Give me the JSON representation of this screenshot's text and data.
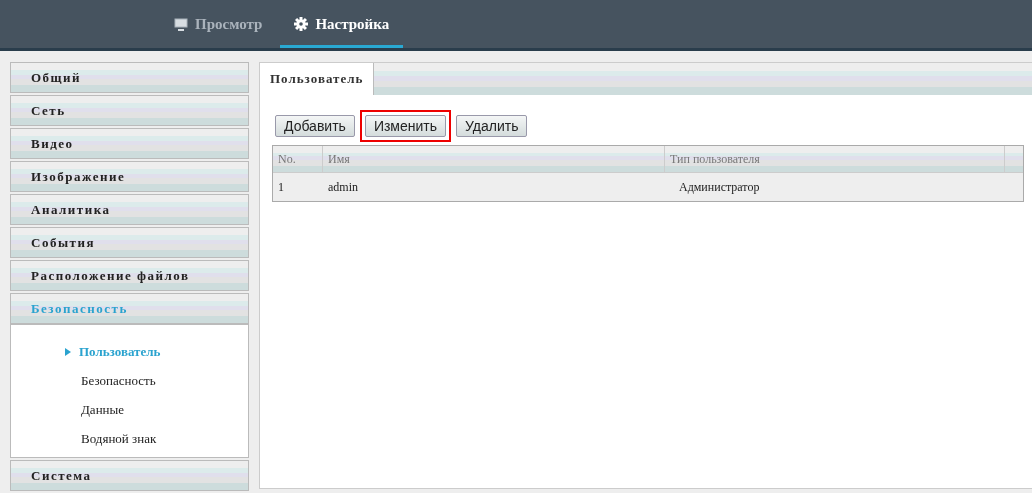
{
  "nav": [
    {
      "label": "Просмотр",
      "selected": false
    },
    {
      "label": "Настройка",
      "selected": true
    }
  ],
  "sidebar": {
    "items": [
      {
        "label": "Общий",
        "selected": false
      },
      {
        "label": "Сеть",
        "selected": false
      },
      {
        "label": "Видео",
        "selected": false
      },
      {
        "label": "Изображение",
        "selected": false
      },
      {
        "label": "Аналитика",
        "selected": false
      },
      {
        "label": "События",
        "selected": false
      },
      {
        "label": "Расположение файлов",
        "selected": false
      },
      {
        "label": "Безопасность",
        "selected": true,
        "expanded": true,
        "children": [
          {
            "label": "Пользователь",
            "selected": true
          },
          {
            "label": "Безопасность",
            "selected": false
          },
          {
            "label": "Данные",
            "selected": false
          },
          {
            "label": "Водяной знак",
            "selected": false
          }
        ]
      },
      {
        "label": "Система",
        "selected": false
      }
    ]
  },
  "tabs": [
    {
      "label": "Пользователь",
      "selected": true
    }
  ],
  "buttons": [
    {
      "label": "Добавить",
      "highlighted": false
    },
    {
      "label": "Изменить",
      "highlighted": true
    },
    {
      "label": "Удалить",
      "highlighted": false
    }
  ],
  "table": {
    "columns": [
      "No.",
      "Имя",
      "Тип пользователя"
    ],
    "rows": [
      [
        "1",
        "admin",
        "Администратор"
      ]
    ]
  }
}
